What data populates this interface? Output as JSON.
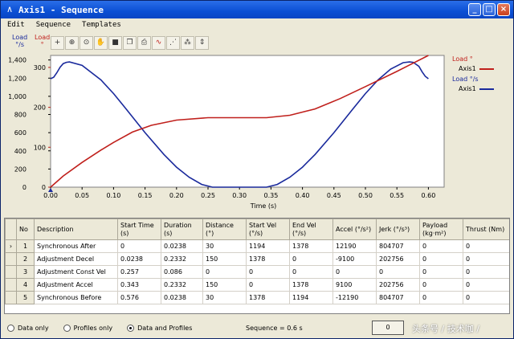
{
  "window": {
    "title": "Axis1 - Sequence"
  },
  "menu": [
    "Edit",
    "Sequence",
    "Templates"
  ],
  "series_header": {
    "velocity_line1": "Load",
    "velocity_line2": "°/s",
    "position_line1": "Load",
    "position_line2": "°"
  },
  "toolbar_icons": [
    "crosshair-icon",
    "zoom-box-icon",
    "zoom-icon",
    "pan-hand-icon",
    "save-icon",
    "copy-icon",
    "print-icon",
    "curve-icon",
    "curve-point-icon",
    "point-label-icon",
    "vertical-scale-icon"
  ],
  "legend": {
    "position_title": "Load °",
    "position_series": "Axis1",
    "position_color": "#c0201c",
    "velocity_title": "Load °/s",
    "velocity_series": "Axis1",
    "velocity_color": "#1a2a9c"
  },
  "chart_data": {
    "type": "line",
    "xlabel": "Time (s)",
    "x_ticks": [
      "0.00",
      "0.05",
      "0.10",
      "0.15",
      "0.20",
      "0.25",
      "0.30",
      "0.35",
      "0.40",
      "0.45",
      "0.50",
      "0.55",
      "0.60"
    ],
    "xlim": [
      0,
      0.625
    ],
    "velocity_axis": {
      "ticks": [
        "0",
        "200",
        "400",
        "600",
        "800",
        "1,000",
        "1,200",
        "1,400"
      ],
      "ylim": [
        0,
        1450
      ]
    },
    "position_axis": {
      "ticks": [
        "0",
        "100",
        "200",
        "300"
      ],
      "ylim": [
        0,
        330
      ]
    },
    "series": [
      {
        "name": "Axis1",
        "axis": "velocity",
        "x": [
          0,
          0.005,
          0.01,
          0.015,
          0.02,
          0.025,
          0.03,
          0.05,
          0.08,
          0.1,
          0.12,
          0.15,
          0.18,
          0.2,
          0.22,
          0.24,
          0.257,
          0.3,
          0.343,
          0.36,
          0.38,
          0.4,
          0.42,
          0.45,
          0.48,
          0.5,
          0.52,
          0.54,
          0.56,
          0.57,
          0.576,
          0.585,
          0.59,
          0.595,
          0.6
        ],
        "y": [
          1194,
          1210,
          1260,
          1320,
          1360,
          1374,
          1378,
          1340,
          1180,
          1030,
          860,
          600,
          360,
          220,
          110,
          30,
          0,
          0,
          0,
          30,
          110,
          220,
          360,
          600,
          860,
          1030,
          1180,
          1300,
          1370,
          1378,
          1374,
          1330,
          1270,
          1220,
          1194
        ]
      },
      {
        "name": "Axis1",
        "axis": "position",
        "x": [
          0,
          0.02,
          0.05,
          0.08,
          0.1,
          0.13,
          0.16,
          0.2,
          0.25,
          0.3,
          0.343,
          0.38,
          0.42,
          0.46,
          0.5,
          0.55,
          0.6
        ],
        "y": [
          0,
          28,
          62,
          93,
          112,
          138,
          155,
          168,
          174,
          174,
          174,
          180,
          196,
          222,
          252,
          290,
          330
        ]
      }
    ]
  },
  "table": {
    "columns": [
      "No",
      "Description",
      "Start Time (s)",
      "Duration (s)",
      "Distance (°)",
      "Start Vel (°/s)",
      "End Vel (°/s)",
      "Accel (°/s²)",
      "Jerk (°/s³)",
      "Payload (kg·m²)",
      "Thrust (Nm)"
    ],
    "rows": [
      [
        "1",
        "Synchronous After",
        "0",
        "0.0238",
        "30",
        "1194",
        "1378",
        "12190",
        "804707",
        "0",
        "0"
      ],
      [
        "2",
        "Adjustment Decel",
        "0.0238",
        "0.2332",
        "150",
        "1378",
        "0",
        "-9100",
        "202756",
        "0",
        "0"
      ],
      [
        "3",
        "Adjustment Const Vel",
        "0.257",
        "0.086",
        "0",
        "0",
        "0",
        "0",
        "0",
        "0",
        "0"
      ],
      [
        "4",
        "Adjustment Accel",
        "0.343",
        "0.2332",
        "150",
        "0",
        "1378",
        "9100",
        "202756",
        "0",
        "0"
      ],
      [
        "5",
        "Synchronous Before",
        "0.576",
        "0.0238",
        "30",
        "1378",
        "1194",
        "-12190",
        "804707",
        "0",
        "0"
      ]
    ],
    "selected_marker": "›"
  },
  "status": {
    "radio_data_only": "Data only",
    "radio_profiles_only": "Profiles only",
    "radio_data_profiles": "Data and Profiles",
    "sequence_text": "Sequence = 0.6 s",
    "ok_label": "0",
    "watermark": "头条号 / 技术咖 /"
  }
}
